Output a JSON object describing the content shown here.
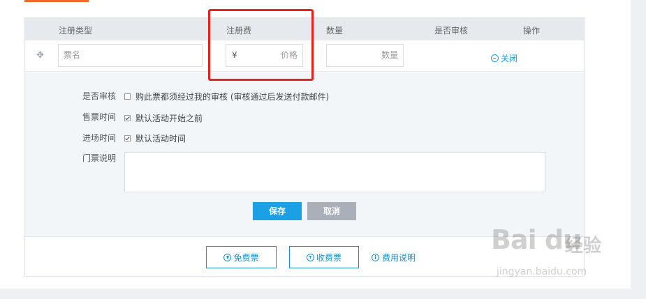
{
  "table": {
    "headers": {
      "type": "注册类型",
      "fee": "注册费",
      "quantity": "数量",
      "review": "是否审核",
      "action": "操作"
    },
    "row": {
      "name_placeholder": "票名",
      "currency_symbol": "¥",
      "price_placeholder": "价格",
      "quantity_placeholder": "数量",
      "close_label": "关闭"
    }
  },
  "details": {
    "review_label": "是否审核",
    "review_option": "购此票都须经过我的审核 (审核通过后发送付款邮件)",
    "review_checked": false,
    "sale_time_label": "售票时间",
    "sale_time_option": "默认活动开始之前",
    "sale_time_checked": true,
    "entry_time_label": "进场时间",
    "entry_time_option": "默认活动时间",
    "entry_time_checked": true,
    "description_label": "门票说明",
    "save_label": "保存",
    "cancel_label": "取消"
  },
  "footer": {
    "free_ticket_label": "免费票",
    "paid_ticket_label": "收费票",
    "fee_info_label": "费用说明"
  },
  "watermark": {
    "logo": "Bai du",
    "cn": "经验",
    "url": "jingyan.baidu.com"
  },
  "colors": {
    "accent": "#1ba0e6",
    "highlight": "#e5231c",
    "top_accent": "#f26a2a"
  }
}
